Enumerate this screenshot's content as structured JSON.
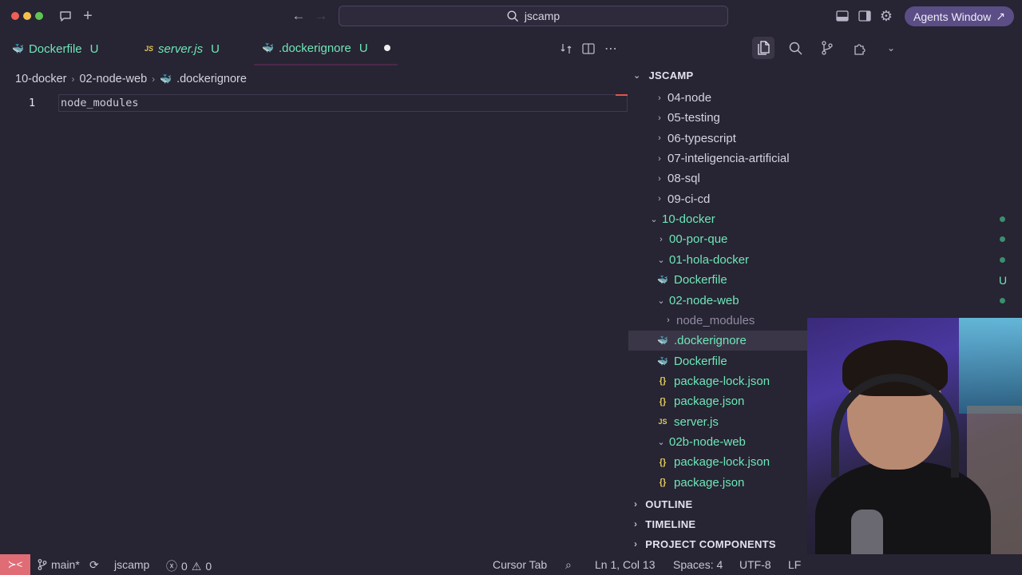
{
  "titlebar": {
    "search_text": "jscamp",
    "agents_label": "Agents Window",
    "agents_icon": "external-arrow-icon"
  },
  "tabs": [
    {
      "name": "Dockerfile",
      "status": "U",
      "icon": "docker-icon"
    },
    {
      "name": "server.js",
      "status": "U",
      "icon": "js-icon"
    },
    {
      "name": ".dockerignore",
      "status": "U",
      "icon": "docker-icon",
      "modified": true
    }
  ],
  "breadcrumb": [
    "10-docker",
    "02-node-web",
    ".dockerignore"
  ],
  "editor": {
    "lines": [
      {
        "num": "1",
        "code": "node_modules"
      }
    ]
  },
  "explorer": {
    "root": "JSCAMP",
    "items": [
      {
        "label": "04-node",
        "chev": "›",
        "icon": "",
        "color": "default"
      },
      {
        "label": "05-testing",
        "chev": "›",
        "icon": "",
        "color": "default"
      },
      {
        "label": "06-typescript",
        "chev": "›",
        "icon": "",
        "color": "default"
      },
      {
        "label": "07-inteligencia-artificial",
        "chev": "›",
        "icon": "",
        "color": "default"
      },
      {
        "label": "08-sql",
        "chev": "›",
        "icon": "",
        "color": "default"
      },
      {
        "label": "09-ci-cd",
        "chev": "›",
        "icon": "",
        "color": "default"
      },
      {
        "label": "10-docker",
        "chev": "⌄",
        "icon": "",
        "color": "green"
      },
      {
        "label": "00-por-que",
        "chev": "›",
        "icon": "",
        "color": "green"
      },
      {
        "label": "01-hola-docker",
        "chev": "⌄",
        "icon": "",
        "color": "green"
      },
      {
        "label": "Dockerfile",
        "chev": "",
        "icon": "🐳",
        "color": "green",
        "badge": "U"
      },
      {
        "label": "02-node-web",
        "chev": "⌄",
        "icon": "",
        "color": "green"
      },
      {
        "label": "node_modules",
        "chev": "›",
        "icon": "",
        "color": "dim"
      },
      {
        "label": ".dockerignore",
        "chev": "",
        "icon": "🐳",
        "color": "green"
      },
      {
        "label": "Dockerfile",
        "chev": "",
        "icon": "🐳",
        "color": "green"
      },
      {
        "label": "package-lock.json",
        "chev": "",
        "icon": "{}",
        "color": "green"
      },
      {
        "label": "package.json",
        "chev": "",
        "icon": "{}",
        "color": "green"
      },
      {
        "label": "server.js",
        "chev": "",
        "icon": "JS",
        "color": "green"
      },
      {
        "label": "02b-node-web",
        "chev": "⌄",
        "icon": "",
        "color": "green"
      },
      {
        "label": "package-lock.json",
        "chev": "",
        "icon": "{}",
        "color": "green"
      },
      {
        "label": "package.json",
        "chev": "",
        "icon": "{}",
        "color": "green"
      }
    ],
    "sections": [
      "OUTLINE",
      "TIMELINE",
      "PROJECT COMPONENTS"
    ]
  },
  "statusbar": {
    "branch": "main*",
    "workspace": "jscamp",
    "errors": "0",
    "warnings": "0",
    "cursor_tab": "Cursor Tab",
    "position": "Ln 1, Col 13",
    "spaces": "Spaces: 4",
    "encoding": "UTF-8",
    "eol": "LF"
  },
  "colors": {
    "accent_green": "#6ee7b7",
    "background": "#272433",
    "remote_badge": "#e06c75",
    "agents_button": "#5b4d86"
  }
}
